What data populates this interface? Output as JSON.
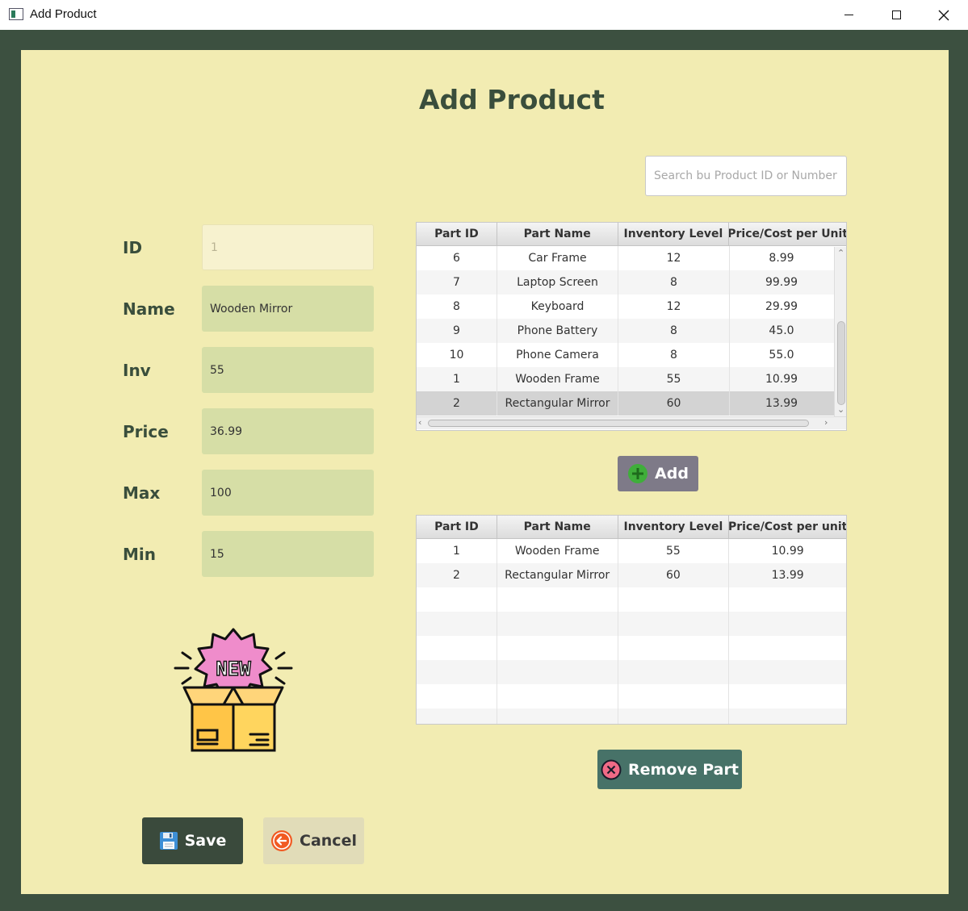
{
  "window": {
    "title": "Add Product"
  },
  "page": {
    "title": "Add Product"
  },
  "search": {
    "placeholder": "Search bu Product ID or Number",
    "value": ""
  },
  "form": {
    "id": {
      "label": "ID",
      "value": "1"
    },
    "name": {
      "label": "Name",
      "value": "Wooden Mirror"
    },
    "inv": {
      "label": "Inv",
      "value": "55"
    },
    "price": {
      "label": "Price",
      "value": "36.99"
    },
    "max": {
      "label": "Max",
      "value": "100"
    },
    "min": {
      "label": "Min",
      "value": "15"
    }
  },
  "parts_table": {
    "headers": [
      "Part ID",
      "Part Name",
      "Inventory Level",
      "Price/Cost per Unit"
    ],
    "rows": [
      [
        "6",
        "Car Frame",
        "12",
        "8.99"
      ],
      [
        "7",
        "Laptop Screen",
        "8",
        "99.99"
      ],
      [
        "8",
        "Keyboard",
        "12",
        "29.99"
      ],
      [
        "9",
        "Phone Battery",
        "8",
        "45.0"
      ],
      [
        "10",
        "Phone Camera",
        "8",
        "55.0"
      ],
      [
        "1",
        "Wooden Frame",
        "55",
        "10.99"
      ],
      [
        "2",
        "Rectangular Mirror",
        "60",
        "13.99"
      ]
    ],
    "selected_row": 6
  },
  "associated_table": {
    "headers": [
      "Part ID",
      "Part Name",
      "Inventory Level",
      "Price/Cost per unit"
    ],
    "rows": [
      [
        "1",
        "Wooden Frame",
        "55",
        "10.99"
      ],
      [
        "2",
        "Rectangular Mirror",
        "60",
        "13.99"
      ]
    ]
  },
  "buttons": {
    "add": "Add",
    "remove": "Remove Part",
    "save": "Save",
    "cancel": "Cancel"
  },
  "illustration": {
    "text": "NEW"
  },
  "colors": {
    "background": "#3c5040",
    "panel": "#f2ecb2",
    "heading": "#3a4e3c",
    "field": "#d6dea6",
    "add_button": "#7e7a88",
    "remove_button": "#477268",
    "save_button": "#3a4a3c",
    "cancel_button": "#e1dcb8"
  }
}
